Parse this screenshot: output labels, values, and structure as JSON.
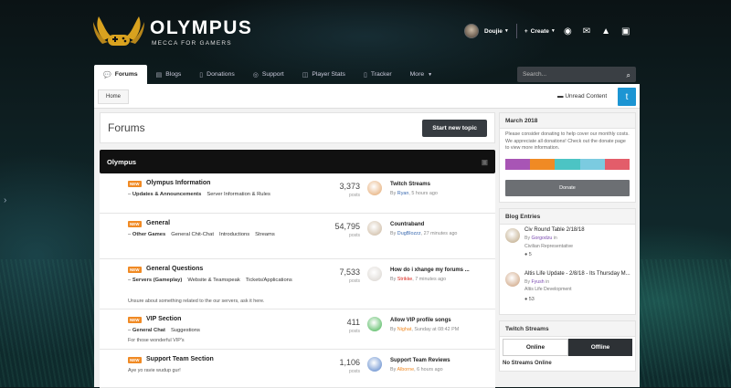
{
  "brand": {
    "title": "OLYMPUS",
    "subtitle": "MECCA FOR GAMERS",
    "gold": "#d9a21f"
  },
  "header": {
    "username": "Doujie",
    "create_label": "Create"
  },
  "nav": {
    "tabs": [
      {
        "label": "Forums",
        "active": true
      },
      {
        "label": "Blogs"
      },
      {
        "label": "Donations"
      },
      {
        "label": "Support"
      },
      {
        "label": "Player Stats"
      },
      {
        "label": "Tracker"
      },
      {
        "label": "More"
      }
    ],
    "search_placeholder": "Search..."
  },
  "breadcrumb": {
    "home": "Home",
    "unread": "Unread Content"
  },
  "main": {
    "title": "Forums",
    "new_topic": "Start new topic",
    "category": "Olympus",
    "badge": "NEW",
    "posts_label": "posts",
    "forums": [
      {
        "name": "Olympus Information",
        "subs": [
          "Updates & Announcements",
          "Server Information & Rules"
        ],
        "desc": "",
        "count": "3,373",
        "last_title": "Twitch Streams",
        "last_by": "By",
        "last_user": "Ryan",
        "last_time": ", 5 hours ago"
      },
      {
        "name": "General",
        "subs": [
          "Other Games",
          "General Chit-Chat",
          "Introductions",
          "Streams"
        ],
        "desc": "",
        "count": "54,795",
        "last_title": "Countraband",
        "last_by": "By",
        "last_user": "DugBlozzz",
        "last_time": ", 27 minutes ago"
      },
      {
        "name": "General Questions",
        "subs": [
          "Servers (Gameplay)",
          "Website & Teamspeak",
          "Tickets/Applications"
        ],
        "desc": "Unsure about something related to the our servers, ask it here.",
        "count": "7,533",
        "last_title": "How do i xhange my forums ...",
        "last_by": "By",
        "last_user": "Strikke",
        "last_time": ", 7 minutes ago"
      },
      {
        "name": "VIP Section",
        "subs": [
          "General Chat",
          "Suggestions"
        ],
        "desc": "For those wonderful VIP's",
        "count": "411",
        "last_title": "Allow VIP profile songs",
        "last_by": "By",
        "last_user": "Nighat",
        "last_time": ", Sunday at 08:42 PM"
      },
      {
        "name": "Support Team Section",
        "subs": [],
        "desc": "Aye yo ravie wudup gur!",
        "count": "1,106",
        "last_title": "Support Team Reviews",
        "last_by": "By",
        "last_user": "Alborne",
        "last_time": ", 6 hours ago"
      }
    ]
  },
  "sidebar": {
    "donation": {
      "title": "March 2018",
      "text": "Please consider donating to help cover our monthly costs. We appreciate all donations! Check out the donate page to view more information.",
      "button": "Donate",
      "colors": [
        "#a855b5",
        "#f08a24",
        "#4cc4c4",
        "#7bcbe0",
        "#e35d6a"
      ]
    },
    "blogs": {
      "title": "Blog Entries",
      "entries": [
        {
          "title": "Civ Round Table 2/18/18",
          "by": "By",
          "user": "Gorgodzu",
          "in": " in",
          "blog": "Civilian Representative",
          "comments": "5"
        },
        {
          "title": "Altis Life Update - 2/8/18 - Its Thursday M...",
          "by": "By",
          "user": "Fyush",
          "in": " in",
          "blog": "Altis Life Development",
          "comments": "53"
        }
      ]
    },
    "streams": {
      "title": "Twitch Streams",
      "online": "Online",
      "offline": "Offline",
      "empty": "No Streams Online"
    }
  }
}
